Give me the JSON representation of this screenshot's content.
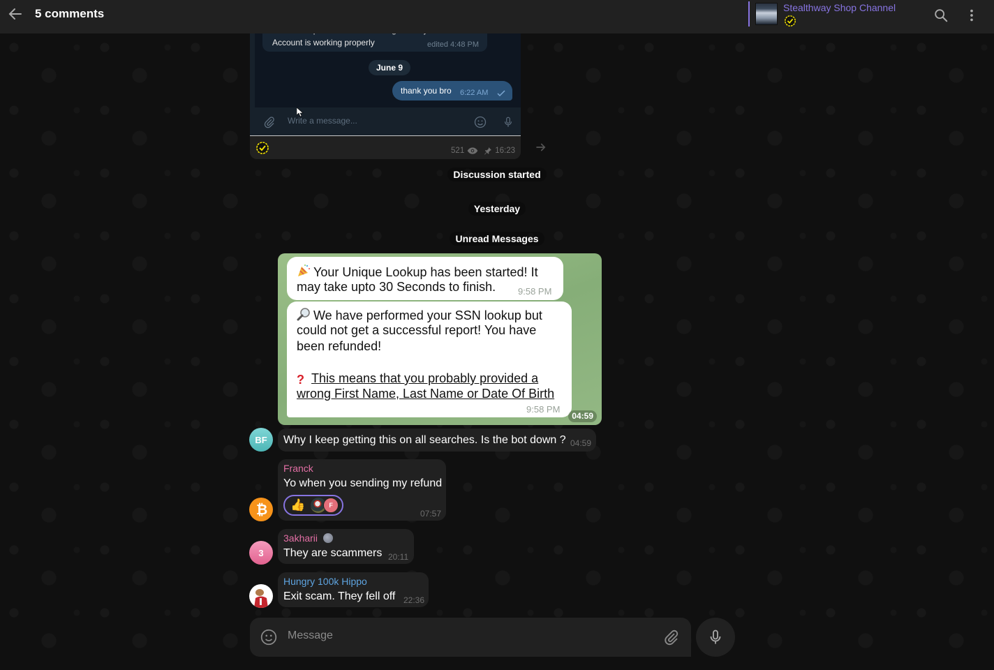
{
  "header": {
    "title": "5 comments",
    "back_icon": "arrow-left-icon",
    "channel_name": "Stealthway Shop Channel",
    "channel_badge": "verified-check-icon",
    "search_icon": "search-icon",
    "menu_icon": "more-vertical-icon"
  },
  "post": {
    "screenshot": {
      "cut_line": "Here is the pic of the helium I bought from you.",
      "line2": "Account is working properly",
      "edited_time": "edited 4:48 PM",
      "date_chip": "June 9",
      "outgoing_text": "thank you bro",
      "outgoing_time": "6:22 AM",
      "write_placeholder": "Write a message..."
    },
    "views": "521",
    "time": "16:23"
  },
  "service": {
    "discussion_started": "Discussion started",
    "yesterday": "Yesterday",
    "unread": "Unread Messages"
  },
  "bot_shot": {
    "msg1_line1": "Your Unique Lookup has been started! It",
    "msg1_line2": "may take upto 30 Seconds to finish.",
    "msg1_time": "9:58 PM",
    "msg2_line1": "We have performed your SSN lookup but",
    "msg2_line2": "could not get a successful report! You have",
    "msg2_line3": "been refunded!",
    "msg2_line4": "This means that you probably provided a",
    "msg2_line5": "wrong First Name, Last Name or Date Of Birth",
    "msg2_time": "9:58 PM",
    "shot_time": "04:59"
  },
  "comments": [
    {
      "initials": "BF",
      "sender": "",
      "text": "Why I keep getting this on all searches. Is the bot down ?",
      "time": "04:59",
      "avatar_color": "#6cc7c7"
    },
    {
      "initials": "",
      "sender": "Franck",
      "text": "Yo when you sending my refund",
      "time": "07:57",
      "avatar_color": "#f7931a",
      "sender_color": "#e36fa5",
      "reactions": {
        "emoji": "👍",
        "reactor_initial": "F"
      }
    },
    {
      "initials": "3",
      "sender": "3akharii",
      "text": "They are scammers",
      "time": "20:11",
      "avatar_color": "#e9709e",
      "sender_color": "#e36fa5"
    },
    {
      "initials": "",
      "sender": "Hungry 100k Hippo",
      "text": "Exit scam. They fell off",
      "time": "22:36",
      "avatar_color": "#ffffff",
      "sender_color": "#5ea4e0"
    }
  ],
  "composer": {
    "placeholder": "Message"
  },
  "colors": {
    "accent": "#8774e1",
    "topbar": "#212121",
    "bubble": "#212121"
  }
}
